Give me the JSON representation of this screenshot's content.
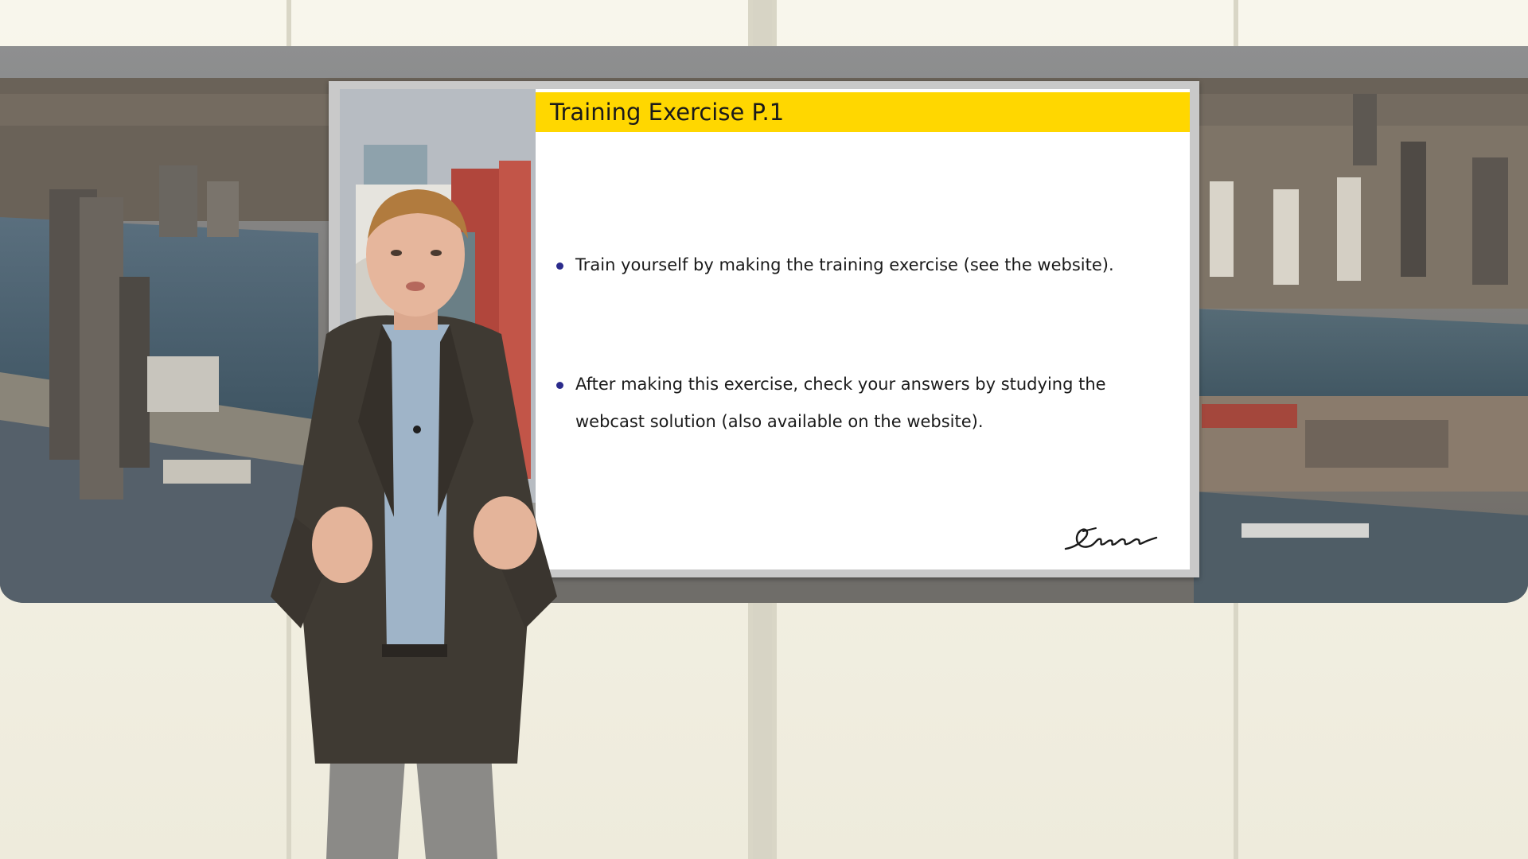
{
  "slide": {
    "title": "Training Exercise P.1",
    "bullets": [
      "Train yourself by making the training exercise (see the website).",
      "After making this exercise, check your answers by studying the webcast solution (also available on the website)."
    ],
    "logo": "Erasmus",
    "logo_icon": "erasmus-signature-logo"
  },
  "colors": {
    "title_bar": "#ffd700",
    "bullet": "#2b2b8c",
    "slide_background": "#ffffff"
  }
}
